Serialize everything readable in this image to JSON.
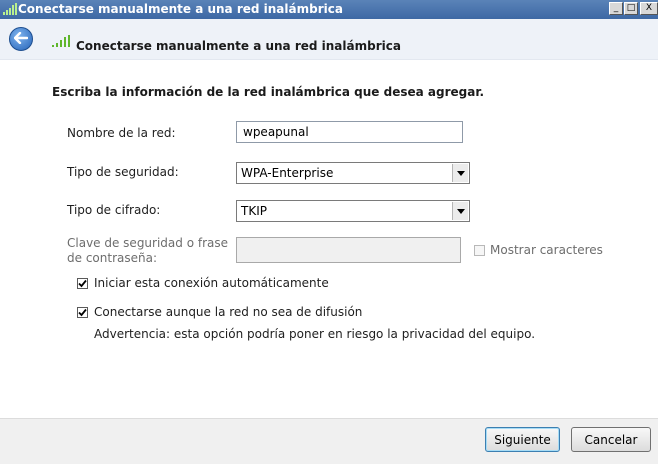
{
  "window": {
    "title": "Conectarse manualmente a una red inalámbrica",
    "controls": {
      "minimize": "_",
      "maximize": "□",
      "close": "X"
    }
  },
  "nav": {
    "title": "Conectarse manualmente a una red inalámbrica"
  },
  "form": {
    "heading": "Escriba la información de la red inalámbrica que desea agregar.",
    "network_name": {
      "label": "Nombre de la red:",
      "value": "wpeapunal"
    },
    "security_type": {
      "label": "Tipo de seguridad:",
      "selected": "WPA-Enterprise"
    },
    "encryption_type": {
      "label": "Tipo de cifrado:",
      "selected": "TKIP"
    },
    "security_key": {
      "label_line1": "Clave de seguridad o frase",
      "label_line2": "de contraseña:",
      "value": "",
      "show_chars_label": "Mostrar caracteres",
      "show_chars_checked": false
    },
    "auto_connect": {
      "label": "Iniciar esta conexión automáticamente",
      "checked": true
    },
    "connect_hidden": {
      "label": "Conectarse aunque la red no sea de difusión",
      "checked": true,
      "warning": "Advertencia: esta opción podría poner en riesgo la privacidad del equipo."
    }
  },
  "footer": {
    "next_label": "Siguiente",
    "cancel_label": "Cancelar"
  },
  "colors": {
    "titlebar": "#3d68a4",
    "navbar": "#eef2f8",
    "footer": "#f0f0f0",
    "signal": "#5fb62c"
  }
}
